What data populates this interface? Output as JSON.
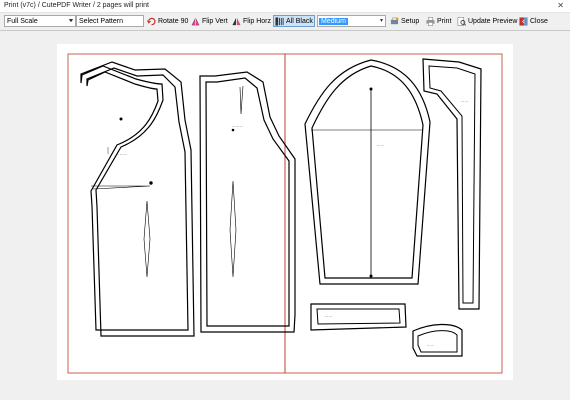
{
  "title": "Print (v7c)  /  CutePDF Writer  /  2 pages will print",
  "toolbar": {
    "scale": "Full Scale",
    "pattern": "Select Pattern",
    "rotate": "Rotate 90",
    "flip_vert": "Flip Vert",
    "flip_horz": "Flip Horz",
    "all_black": "All Black",
    "line_weight": "Medium",
    "setup": "Setup",
    "print": "Print",
    "update_preview": "Update Preview",
    "close": "Close"
  }
}
